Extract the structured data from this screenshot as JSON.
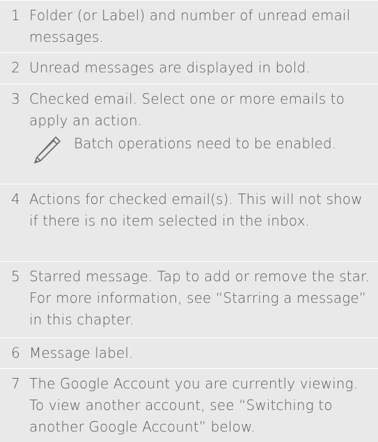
{
  "legend": {
    "items": [
      {
        "number": "1",
        "text": "Folder (or Label) and number of unread email messages."
      },
      {
        "number": "2",
        "text": "Unread messages are displayed in bold."
      },
      {
        "number": "3",
        "text": "Checked email. Select one or more emails to apply an action.",
        "note": "Batch operations need to be enabled."
      },
      {
        "number": "4",
        "text": "Actions for checked email(s). This will not show if there is no item selected in the inbox."
      },
      {
        "number": "5",
        "text": "Starred message. Tap to add or remove the star. For more information, see “Starring a message” in this chapter."
      },
      {
        "number": "6",
        "text": "Message label."
      },
      {
        "number": "7",
        "text": "The Google Account you are currently viewing. To view another account, see “Switching to another Google Account” below."
      }
    ],
    "note_icon": "pencil-icon"
  }
}
